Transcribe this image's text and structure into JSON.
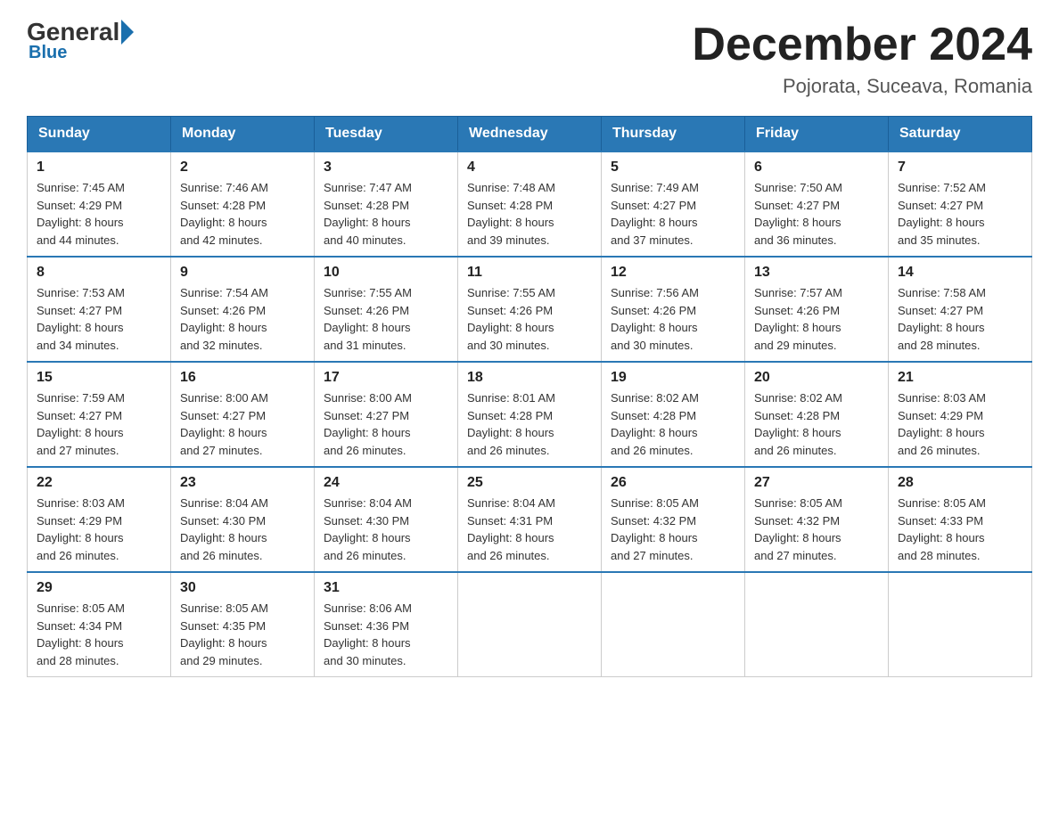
{
  "header": {
    "logo": {
      "general": "General",
      "blue": "Blue"
    },
    "title": "December 2024",
    "location": "Pojorata, Suceava, Romania"
  },
  "weekdays": [
    "Sunday",
    "Monday",
    "Tuesday",
    "Wednesday",
    "Thursday",
    "Friday",
    "Saturday"
  ],
  "weeks": [
    [
      {
        "day": "1",
        "sunrise": "Sunrise: 7:45 AM",
        "sunset": "Sunset: 4:29 PM",
        "daylight": "Daylight: 8 hours",
        "daylight2": "and 44 minutes."
      },
      {
        "day": "2",
        "sunrise": "Sunrise: 7:46 AM",
        "sunset": "Sunset: 4:28 PM",
        "daylight": "Daylight: 8 hours",
        "daylight2": "and 42 minutes."
      },
      {
        "day": "3",
        "sunrise": "Sunrise: 7:47 AM",
        "sunset": "Sunset: 4:28 PM",
        "daylight": "Daylight: 8 hours",
        "daylight2": "and 40 minutes."
      },
      {
        "day": "4",
        "sunrise": "Sunrise: 7:48 AM",
        "sunset": "Sunset: 4:28 PM",
        "daylight": "Daylight: 8 hours",
        "daylight2": "and 39 minutes."
      },
      {
        "day": "5",
        "sunrise": "Sunrise: 7:49 AM",
        "sunset": "Sunset: 4:27 PM",
        "daylight": "Daylight: 8 hours",
        "daylight2": "and 37 minutes."
      },
      {
        "day": "6",
        "sunrise": "Sunrise: 7:50 AM",
        "sunset": "Sunset: 4:27 PM",
        "daylight": "Daylight: 8 hours",
        "daylight2": "and 36 minutes."
      },
      {
        "day": "7",
        "sunrise": "Sunrise: 7:52 AM",
        "sunset": "Sunset: 4:27 PM",
        "daylight": "Daylight: 8 hours",
        "daylight2": "and 35 minutes."
      }
    ],
    [
      {
        "day": "8",
        "sunrise": "Sunrise: 7:53 AM",
        "sunset": "Sunset: 4:27 PM",
        "daylight": "Daylight: 8 hours",
        "daylight2": "and 34 minutes."
      },
      {
        "day": "9",
        "sunrise": "Sunrise: 7:54 AM",
        "sunset": "Sunset: 4:26 PM",
        "daylight": "Daylight: 8 hours",
        "daylight2": "and 32 minutes."
      },
      {
        "day": "10",
        "sunrise": "Sunrise: 7:55 AM",
        "sunset": "Sunset: 4:26 PM",
        "daylight": "Daylight: 8 hours",
        "daylight2": "and 31 minutes."
      },
      {
        "day": "11",
        "sunrise": "Sunrise: 7:55 AM",
        "sunset": "Sunset: 4:26 PM",
        "daylight": "Daylight: 8 hours",
        "daylight2": "and 30 minutes."
      },
      {
        "day": "12",
        "sunrise": "Sunrise: 7:56 AM",
        "sunset": "Sunset: 4:26 PM",
        "daylight": "Daylight: 8 hours",
        "daylight2": "and 30 minutes."
      },
      {
        "day": "13",
        "sunrise": "Sunrise: 7:57 AM",
        "sunset": "Sunset: 4:26 PM",
        "daylight": "Daylight: 8 hours",
        "daylight2": "and 29 minutes."
      },
      {
        "day": "14",
        "sunrise": "Sunrise: 7:58 AM",
        "sunset": "Sunset: 4:27 PM",
        "daylight": "Daylight: 8 hours",
        "daylight2": "and 28 minutes."
      }
    ],
    [
      {
        "day": "15",
        "sunrise": "Sunrise: 7:59 AM",
        "sunset": "Sunset: 4:27 PM",
        "daylight": "Daylight: 8 hours",
        "daylight2": "and 27 minutes."
      },
      {
        "day": "16",
        "sunrise": "Sunrise: 8:00 AM",
        "sunset": "Sunset: 4:27 PM",
        "daylight": "Daylight: 8 hours",
        "daylight2": "and 27 minutes."
      },
      {
        "day": "17",
        "sunrise": "Sunrise: 8:00 AM",
        "sunset": "Sunset: 4:27 PM",
        "daylight": "Daylight: 8 hours",
        "daylight2": "and 26 minutes."
      },
      {
        "day": "18",
        "sunrise": "Sunrise: 8:01 AM",
        "sunset": "Sunset: 4:28 PM",
        "daylight": "Daylight: 8 hours",
        "daylight2": "and 26 minutes."
      },
      {
        "day": "19",
        "sunrise": "Sunrise: 8:02 AM",
        "sunset": "Sunset: 4:28 PM",
        "daylight": "Daylight: 8 hours",
        "daylight2": "and 26 minutes."
      },
      {
        "day": "20",
        "sunrise": "Sunrise: 8:02 AM",
        "sunset": "Sunset: 4:28 PM",
        "daylight": "Daylight: 8 hours",
        "daylight2": "and 26 minutes."
      },
      {
        "day": "21",
        "sunrise": "Sunrise: 8:03 AM",
        "sunset": "Sunset: 4:29 PM",
        "daylight": "Daylight: 8 hours",
        "daylight2": "and 26 minutes."
      }
    ],
    [
      {
        "day": "22",
        "sunrise": "Sunrise: 8:03 AM",
        "sunset": "Sunset: 4:29 PM",
        "daylight": "Daylight: 8 hours",
        "daylight2": "and 26 minutes."
      },
      {
        "day": "23",
        "sunrise": "Sunrise: 8:04 AM",
        "sunset": "Sunset: 4:30 PM",
        "daylight": "Daylight: 8 hours",
        "daylight2": "and 26 minutes."
      },
      {
        "day": "24",
        "sunrise": "Sunrise: 8:04 AM",
        "sunset": "Sunset: 4:30 PM",
        "daylight": "Daylight: 8 hours",
        "daylight2": "and 26 minutes."
      },
      {
        "day": "25",
        "sunrise": "Sunrise: 8:04 AM",
        "sunset": "Sunset: 4:31 PM",
        "daylight": "Daylight: 8 hours",
        "daylight2": "and 26 minutes."
      },
      {
        "day": "26",
        "sunrise": "Sunrise: 8:05 AM",
        "sunset": "Sunset: 4:32 PM",
        "daylight": "Daylight: 8 hours",
        "daylight2": "and 27 minutes."
      },
      {
        "day": "27",
        "sunrise": "Sunrise: 8:05 AM",
        "sunset": "Sunset: 4:32 PM",
        "daylight": "Daylight: 8 hours",
        "daylight2": "and 27 minutes."
      },
      {
        "day": "28",
        "sunrise": "Sunrise: 8:05 AM",
        "sunset": "Sunset: 4:33 PM",
        "daylight": "Daylight: 8 hours",
        "daylight2": "and 28 minutes."
      }
    ],
    [
      {
        "day": "29",
        "sunrise": "Sunrise: 8:05 AM",
        "sunset": "Sunset: 4:34 PM",
        "daylight": "Daylight: 8 hours",
        "daylight2": "and 28 minutes."
      },
      {
        "day": "30",
        "sunrise": "Sunrise: 8:05 AM",
        "sunset": "Sunset: 4:35 PM",
        "daylight": "Daylight: 8 hours",
        "daylight2": "and 29 minutes."
      },
      {
        "day": "31",
        "sunrise": "Sunrise: 8:06 AM",
        "sunset": "Sunset: 4:36 PM",
        "daylight": "Daylight: 8 hours",
        "daylight2": "and 30 minutes."
      },
      null,
      null,
      null,
      null
    ]
  ]
}
